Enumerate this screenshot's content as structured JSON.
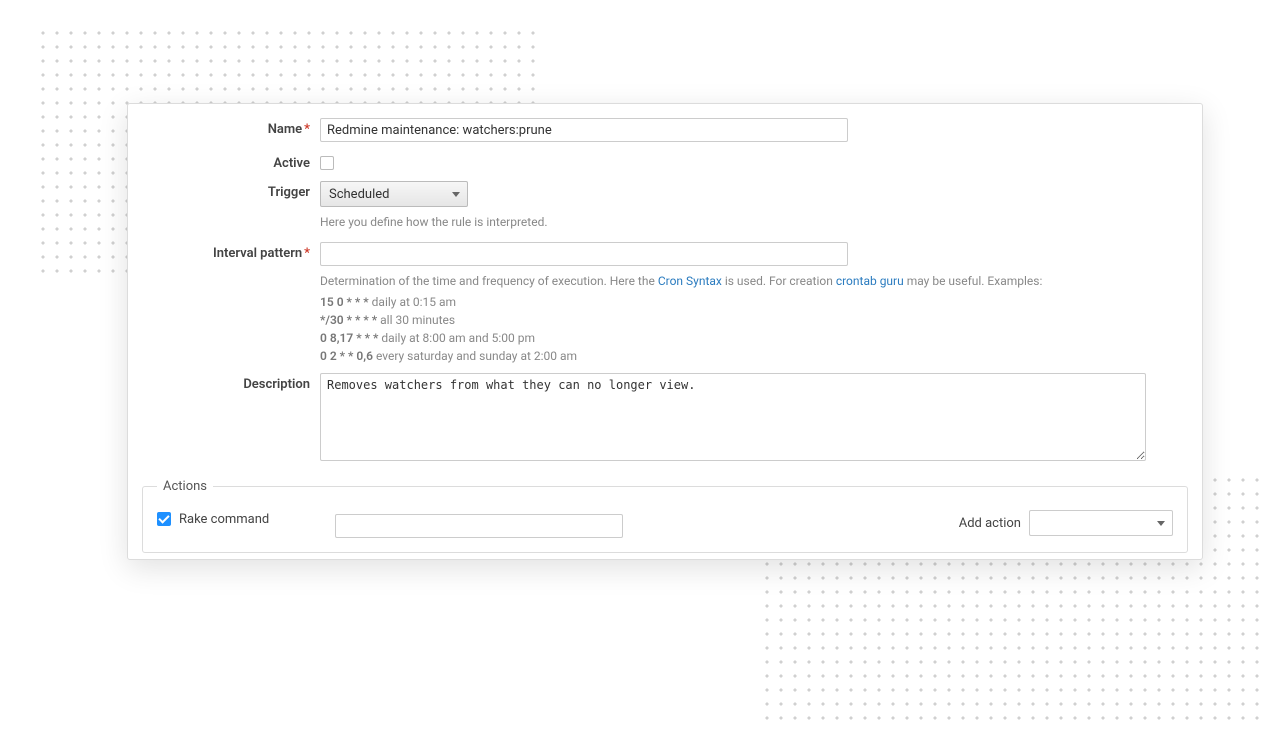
{
  "labels": {
    "name": "Name",
    "active": "Active",
    "trigger": "Trigger",
    "interval": "Interval pattern",
    "description": "Description",
    "actions_legend": "Actions",
    "rake_command": "Rake command",
    "add_action": "Add action"
  },
  "fields": {
    "name_value": "Redmine maintenance: watchers:prune",
    "active_checked": false,
    "trigger_value": "Scheduled",
    "interval_value": "",
    "description_value": "Removes watchers from what they can no longer view.",
    "rake_checked": true,
    "rake_value": "",
    "add_action_value": ""
  },
  "hints": {
    "trigger": "Here you define how the rule is interpreted.",
    "interval_prefix": "Determination of the time and frequency of execution. Here the ",
    "cron_syntax_link": "Cron Syntax",
    "interval_mid": " is used. For creation ",
    "crontab_guru_link": "crontab guru",
    "interval_suffix": " may be useful. Examples:"
  },
  "examples": [
    {
      "pattern": "15 0 * * *",
      "desc": "daily at 0:15 am"
    },
    {
      "pattern": "*/30 * * * *",
      "desc": "all 30 minutes"
    },
    {
      "pattern": "0 8,17 * * *",
      "desc": "daily at 8:00 am and 5:00 pm"
    },
    {
      "pattern": "0 2 * * 0,6",
      "desc": "every saturday and sunday at 2:00 am"
    }
  ]
}
